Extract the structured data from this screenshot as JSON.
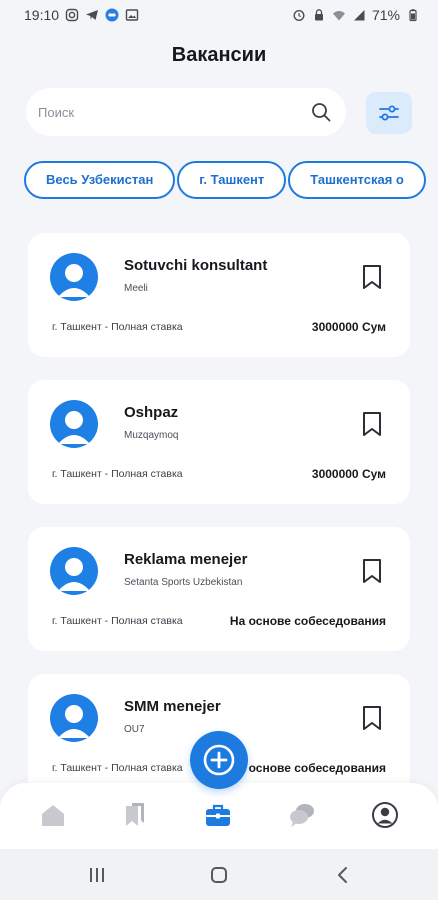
{
  "status_bar": {
    "time": "19:10",
    "battery": "71%"
  },
  "header": {
    "title": "Вакансии"
  },
  "search": {
    "placeholder": "Поиск"
  },
  "chips": [
    "Весь Узбекистан",
    "г. Ташкент",
    "Ташкентская о"
  ],
  "jobs": [
    {
      "title": "Sotuvchi konsultant",
      "company": "Meeli",
      "meta": "г. Ташкент - Полная ставка",
      "salary": "3000000 Сум"
    },
    {
      "title": "Oshpaz",
      "company": "Muzqaymoq",
      "meta": "г. Ташкент - Полная ставка",
      "salary": "3000000 Сум"
    },
    {
      "title": "Reklama menejer",
      "company": "Setanta Sports Uzbekistan",
      "meta": "г. Ташкент - Полная ставка",
      "salary": "На основе собеседования"
    },
    {
      "title": "SMM menejer",
      "company": "OU7",
      "meta": "г. Ташкент - Полная ставка",
      "salary": "На основе собеседования"
    }
  ],
  "nav": {
    "items": [
      "home-icon",
      "bookmarks-icon",
      "briefcase-icon",
      "chat-icon",
      "profile-icon"
    ],
    "active": "briefcase-icon"
  },
  "colors": {
    "accent": "#1d7be0",
    "background": "#f3f5f9",
    "card": "#ffffff"
  }
}
